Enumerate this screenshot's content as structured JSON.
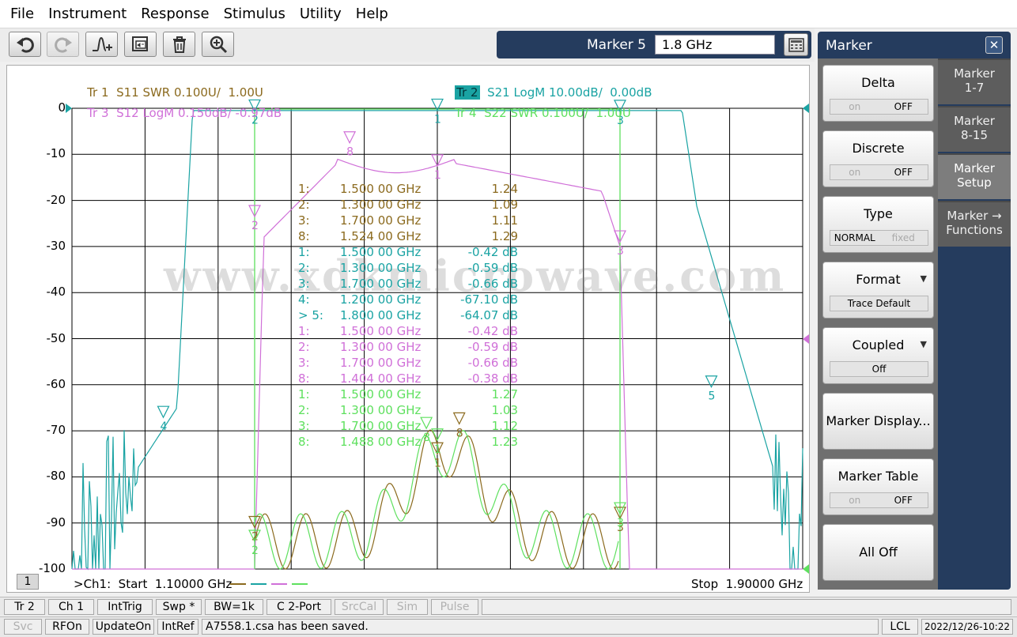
{
  "menu": [
    "File",
    "Instrument",
    "Response",
    "Stimulus",
    "Utility",
    "Help"
  ],
  "toolbar": {
    "icons": [
      "undo-icon",
      "redo-icon",
      "marker-add-icon",
      "capture-icon",
      "trash-icon",
      "zoom-icon"
    ]
  },
  "marker_entry": {
    "label": "Marker 5",
    "value": "1.8 GHz"
  },
  "traces": [
    {
      "id": "Tr 1",
      "desc": "S11 SWR 0.100U/  1.00U",
      "color": "#8b6a1e"
    },
    {
      "id": "Tr 2",
      "desc": "S21 LogM 10.00dB/  0.00dB",
      "color": "#1aa3a3"
    },
    {
      "id": "Tr 3",
      "desc": "S12 LogM 0.150dB/ -0.97dB",
      "color": "#d070d8"
    },
    {
      "id": "Tr 4",
      "desc": "S22 SWR 0.100U/  1.00U",
      "color": "#5ee05e"
    }
  ],
  "y_ticks": [
    "0",
    "-10",
    "-20",
    "-30",
    "-40",
    "-50",
    "-60",
    "-70",
    "-80",
    "-90",
    "-100"
  ],
  "marker_table": [
    {
      "n": "1:",
      "f": "1.500 00 GHz",
      "v": "1.24",
      "c": "#8b6a1e"
    },
    {
      "n": "2:",
      "f": "1.300 00 GHz",
      "v": "1.09",
      "c": "#8b6a1e"
    },
    {
      "n": "3:",
      "f": "1.700 00 GHz",
      "v": "1.11",
      "c": "#8b6a1e"
    },
    {
      "n": "8:",
      "f": "1.524 00 GHz",
      "v": "1.29",
      "c": "#8b6a1e"
    },
    {
      "n": "1:",
      "f": "1.500 00 GHz",
      "v": "-0.42 dB",
      "c": "#1aa3a3"
    },
    {
      "n": "2:",
      "f": "1.300 00 GHz",
      "v": "-0.59 dB",
      "c": "#1aa3a3"
    },
    {
      "n": "3:",
      "f": "1.700 00 GHz",
      "v": "-0.66 dB",
      "c": "#1aa3a3"
    },
    {
      "n": "4:",
      "f": "1.200 00 GHz",
      "v": "-67.10 dB",
      "c": "#1aa3a3"
    },
    {
      "n": "> 5:",
      "f": "1.800 00 GHz",
      "v": "-64.07 dB",
      "c": "#1aa3a3"
    },
    {
      "n": "1:",
      "f": "1.500 00 GHz",
      "v": "-0.42 dB",
      "c": "#d070d8"
    },
    {
      "n": "2:",
      "f": "1.300 00 GHz",
      "v": "-0.59 dB",
      "c": "#d070d8"
    },
    {
      "n": "3:",
      "f": "1.700 00 GHz",
      "v": "-0.66 dB",
      "c": "#d070d8"
    },
    {
      "n": "8:",
      "f": "1.404 00 GHz",
      "v": "-0.38 dB",
      "c": "#d070d8"
    },
    {
      "n": "1:",
      "f": "1.500 00 GHz",
      "v": "1.27",
      "c": "#5ee05e"
    },
    {
      "n": "2:",
      "f": "1.300 00 GHz",
      "v": "1.03",
      "c": "#5ee05e"
    },
    {
      "n": "3:",
      "f": "1.700 00 GHz",
      "v": "1.12",
      "c": "#5ee05e"
    },
    {
      "n": "8:",
      "f": "1.488 00 GHz",
      "v": "1.23",
      "c": "#5ee05e"
    }
  ],
  "watermark": "www.xdkmicrowave.com",
  "channel": {
    "number": "1",
    "start": ">Ch1:  Start  1.10000 GHz",
    "stop": "Stop  1.90000 GHz"
  },
  "side_panel": {
    "title": "Marker",
    "softkeys": [
      {
        "label": "Delta",
        "on": "on",
        "off": "OFF"
      },
      {
        "label": "Discrete",
        "on": "on",
        "off": "OFF"
      },
      {
        "label": "Type",
        "on": "NORMAL",
        "off": "fixed"
      },
      {
        "label": "Format",
        "value": "Trace Default"
      },
      {
        "label": "Coupled",
        "value": "Off"
      },
      {
        "label": "Marker Display..."
      },
      {
        "label": "Marker Table",
        "on": "on",
        "off": "OFF"
      },
      {
        "label": "All Off"
      }
    ],
    "tabs": [
      "Marker\n1-7",
      "Marker\n8-15",
      "Marker\nSetup",
      "Marker →\nFunctions"
    ]
  },
  "status_row1": [
    "Tr 2",
    "Ch 1",
    "IntTrig",
    "Swp *",
    "BW=1k",
    "C  2-Port",
    "SrcCal",
    "Sim",
    "Pulse"
  ],
  "status_row2": [
    "Svc",
    "RFOn",
    "UpdateOn",
    "IntRef",
    "A7558.1.csa has been saved.",
    "LCL",
    "2022/12/26-10:22"
  ]
}
